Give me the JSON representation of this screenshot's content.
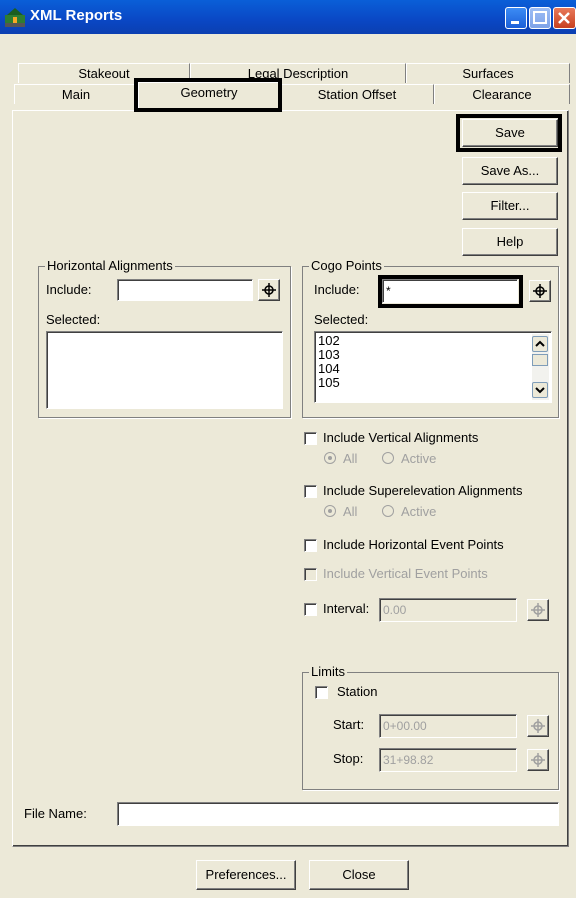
{
  "window": {
    "title": "XML Reports"
  },
  "tabs": {
    "back_row": [
      "Stakeout",
      "Legal Description",
      "Surfaces"
    ],
    "front_row": [
      "Main",
      "Geometry",
      "Station Offset",
      "Clearance"
    ]
  },
  "buttons": {
    "save": "Save",
    "save_as": "Save As...",
    "filter": "Filter...",
    "help": "Help",
    "preferences": "Preferences...",
    "close": "Close"
  },
  "horizontal": {
    "legend": "Horizontal Alignments",
    "include_label": "Include:",
    "include_value": "",
    "selected_label": "Selected:"
  },
  "cogo": {
    "legend": "Cogo Points",
    "include_label": "Include:",
    "include_value": "*",
    "selected_label": "Selected:",
    "items": [
      "102",
      "103",
      "104",
      "105"
    ]
  },
  "options": {
    "vertical_alignments": "Include Vertical Alignments",
    "superelevation_alignments": "Include Superelevation Alignments",
    "all": "All",
    "active": "Active",
    "horizontal_event_points": "Include Horizontal Event Points",
    "vertical_event_points": "Include Vertical Event Points",
    "interval_label": "Interval:",
    "interval_value": "0.00"
  },
  "limits": {
    "legend": "Limits",
    "station_label": "Station",
    "start_label": "Start:",
    "start_value": "0+00.00",
    "stop_label": "Stop:",
    "stop_value": "31+98.82"
  },
  "file": {
    "label": "File Name:",
    "value": ""
  },
  "colors": {
    "titlebar": "#0a47c4",
    "dialog_bg": "#ece9d8"
  },
  "icons": {
    "app": "app-icon",
    "target": "pick-target-icon"
  }
}
